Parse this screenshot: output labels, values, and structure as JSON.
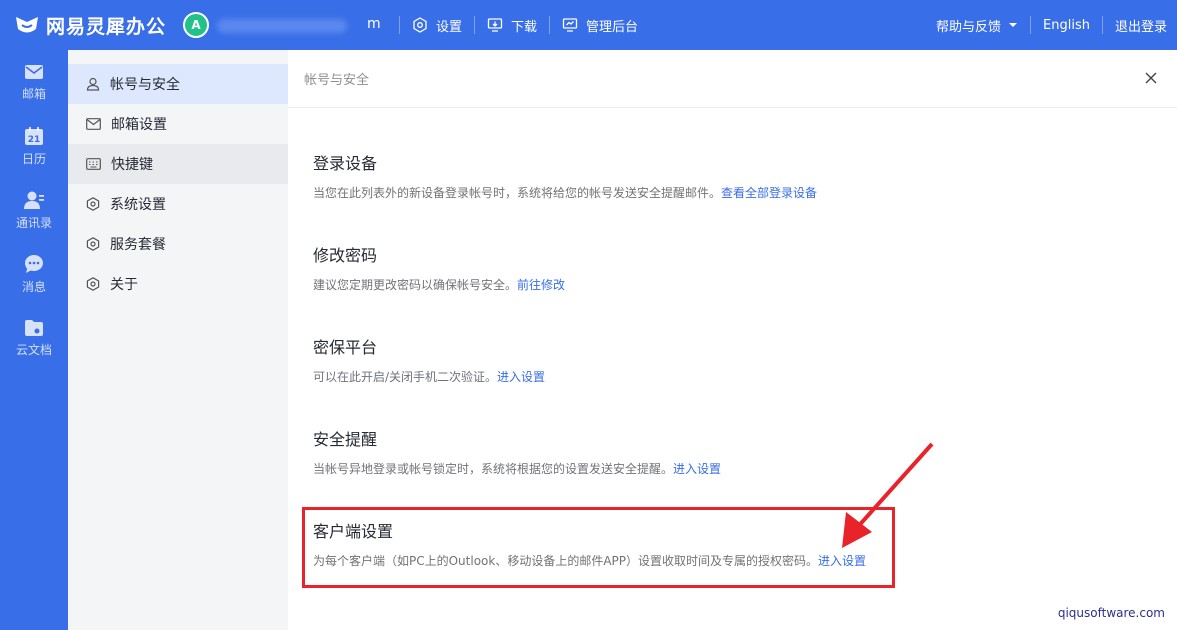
{
  "app": {
    "name": "网易灵犀办公",
    "avatar_letter": "A",
    "account_tail": "m"
  },
  "topnav": {
    "settings": "设置",
    "download": "下载",
    "admin": "管理后台",
    "help": "帮助与反馈",
    "language": "English",
    "logout": "退出登录"
  },
  "rail": [
    {
      "label": "邮箱",
      "icon": "mail-icon"
    },
    {
      "label": "日历",
      "icon": "calendar-icon",
      "badge": "21"
    },
    {
      "label": "通讯录",
      "icon": "contacts-icon"
    },
    {
      "label": "消息",
      "icon": "chat-icon"
    },
    {
      "label": "云文档",
      "icon": "cloud-docs-icon"
    }
  ],
  "sidebar": {
    "items": [
      {
        "label": "帐号与安全",
        "icon": "user-icon"
      },
      {
        "label": "邮箱设置",
        "icon": "mail-icon"
      },
      {
        "label": "快捷键",
        "icon": "keyboard-icon"
      },
      {
        "label": "系统设置",
        "icon": "hexagon-gear-icon"
      },
      {
        "label": "服务套餐",
        "icon": "hexagon-gear-icon"
      },
      {
        "label": "关于",
        "icon": "hexagon-gear-icon"
      }
    ]
  },
  "content": {
    "title": "帐号与安全",
    "sections": [
      {
        "title": "登录设备",
        "desc": "当您在此列表外的新设备登录帐号时，系统将给您的帐号发送安全提醒邮件。",
        "link": "查看全部登录设备"
      },
      {
        "title": "修改密码",
        "desc": "建议您定期更改密码以确保帐号安全。",
        "link": "前往修改"
      },
      {
        "title": "密保平台",
        "desc": "可以在此开启/关闭手机二次验证。",
        "link": "进入设置"
      },
      {
        "title": "安全提醒",
        "desc": "当帐号异地登录或帐号锁定时，系统将根据您的设置发送安全提醒。",
        "link": "进入设置"
      },
      {
        "title": "客户端设置",
        "desc": "为每个客户端（如PC上的Outlook、移动设备上的邮件APP）设置收取时间及专属的授权密码。",
        "link": "进入设置"
      }
    ]
  },
  "watermark": "qiqusoftware.com",
  "colors": {
    "brand": "#386ee7",
    "highlight": "#e8242a",
    "active_bg": "#dde8fe"
  }
}
